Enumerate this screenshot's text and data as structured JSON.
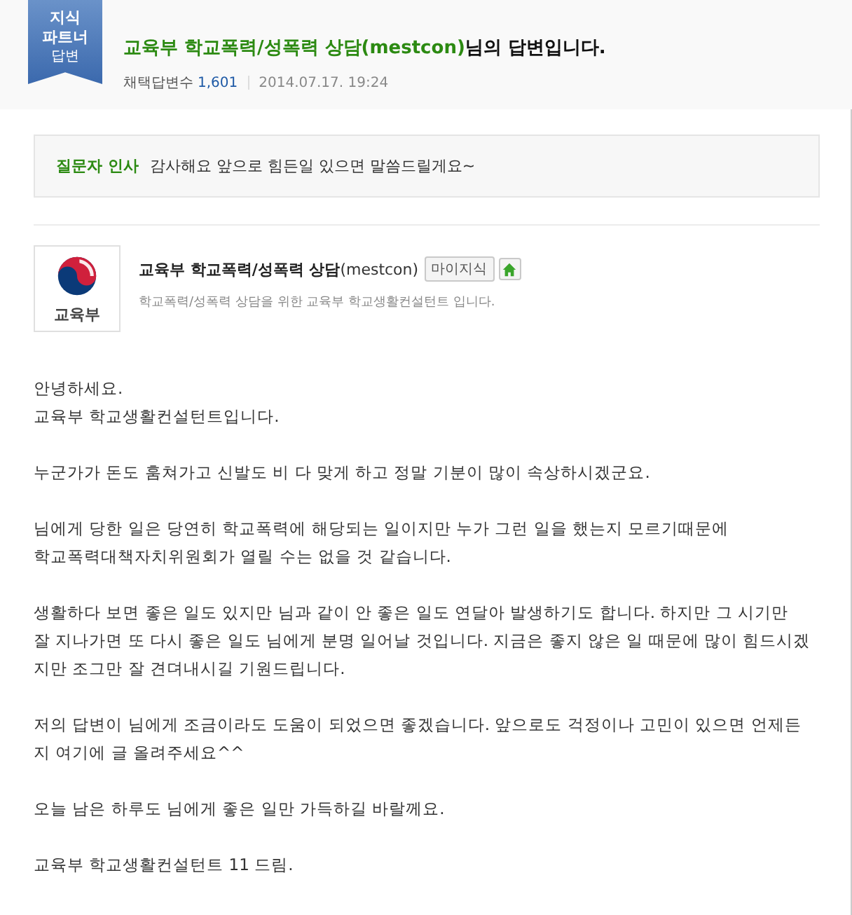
{
  "badge": {
    "lines": [
      "지식",
      "파트너",
      "답변"
    ]
  },
  "title": {
    "answerer": "교육부 학교폭력/성폭력 상담(mestcon)",
    "suffix": "님의 답변입니다."
  },
  "meta": {
    "adopted_label": "채택답변수",
    "adopted_count": "1,601",
    "date": "2014.07.17. 19:24"
  },
  "greeting": {
    "label": "질문자 인사",
    "text": "감사해요 앞으로 힘든일 있으면 말씀드릴게요~"
  },
  "profile": {
    "logo_text": "교육부",
    "name": "교육부 학교폭력/성폭력 상담",
    "account": "(mestcon)",
    "my_button": "마이지식",
    "description": "학교폭력/성폭력 상담을 위한 교육부 학교생활컨설턴트 입니다."
  },
  "answer": [
    [
      "안녕하세요.",
      "교육부 학교생활컨설턴트입니다."
    ],
    [
      "누군가가 돈도 훔쳐가고 신발도 비 다 맞게 하고 정말 기분이 많이 속상하시겠군요."
    ],
    [
      "님에게 당한 일은 당연히 학교폭력에 해당되는 일이지만 누가 그런 일을 했는지 모르기때문에",
      "학교폭력대책자치위원회가 열릴 수는 없을 것 같습니다."
    ],
    [
      "생활하다 보면 좋은 일도 있지만 님과 같이 안 좋은 일도 연달아 발생하기도 합니다. 하지만 그 시기만",
      "잘 지나가면 또 다시 좋은 일도 님에게 분명 일어날 것입니다. 지금은 좋지 않은 일 때문에 많이 힘드시겠",
      "지만 조그만 잘 견뎌내시길 기원드립니다."
    ],
    [
      "저의 답변이 님에게 조금이라도 도움이 되었으면 좋겠습니다. 앞으로도 걱정이나 고민이 있으면 언제든",
      "지 여기에 글 올려주세요^^"
    ],
    [
      "오늘 남은 하루도 님에게 좋은 일만 가득하길 바랄께요."
    ],
    [
      "교육부 학교생활컨설턴트 11 드림."
    ]
  ]
}
